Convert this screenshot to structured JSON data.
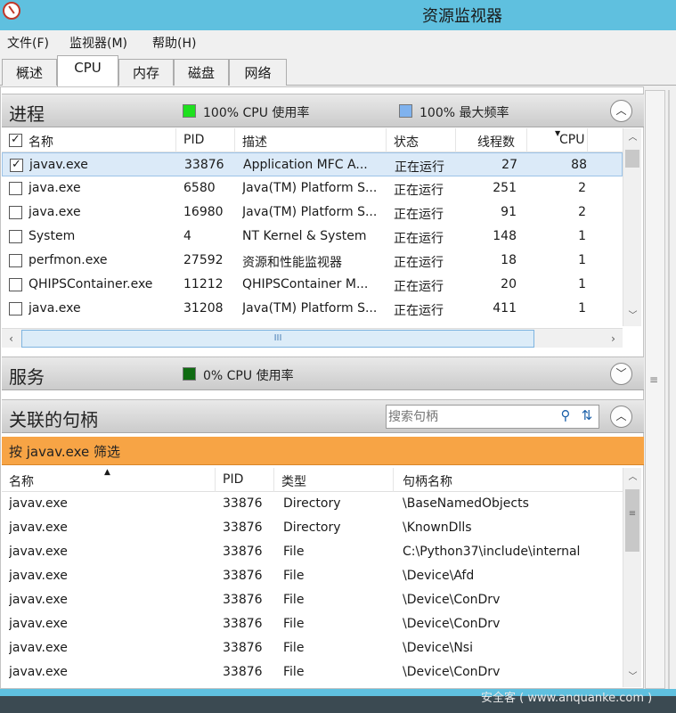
{
  "window": {
    "title": "资源监视器"
  },
  "menu": [
    "文件(F)",
    "监视器(M)",
    "帮助(H)"
  ],
  "tabs": [
    "概述",
    "CPU",
    "内存",
    "磁盘",
    "网络"
  ],
  "active_tab": "CPU",
  "processes": {
    "title": "进程",
    "cpu_legend": "100% CPU 使用率",
    "freq_legend": "100% 最大频率",
    "legend_colors": {
      "cpu": "#1ee01e",
      "freq": "#7fb2ee"
    },
    "columns": [
      "名称",
      "PID",
      "描述",
      "状态",
      "线程数",
      "CPU"
    ],
    "rows": [
      {
        "name": "javav.exe",
        "pid": "33876",
        "desc": "Application MFC A...",
        "status": "正在运行",
        "threads": "27",
        "cpu": "88",
        "checked": true
      },
      {
        "name": "java.exe",
        "pid": "6580",
        "desc": "Java(TM) Platform S...",
        "status": "正在运行",
        "threads": "251",
        "cpu": "2",
        "checked": false
      },
      {
        "name": "java.exe",
        "pid": "16980",
        "desc": "Java(TM) Platform S...",
        "status": "正在运行",
        "threads": "91",
        "cpu": "2",
        "checked": false
      },
      {
        "name": "System",
        "pid": "4",
        "desc": "NT Kernel & System",
        "status": "正在运行",
        "threads": "148",
        "cpu": "1",
        "checked": false
      },
      {
        "name": "perfmon.exe",
        "pid": "27592",
        "desc": "资源和性能监视器",
        "status": "正在运行",
        "threads": "18",
        "cpu": "1",
        "checked": false
      },
      {
        "name": "QHIPSContainer.exe",
        "pid": "11212",
        "desc": "QHIPSContainer M...",
        "status": "正在运行",
        "threads": "20",
        "cpu": "1",
        "checked": false
      },
      {
        "name": "java.exe",
        "pid": "31208",
        "desc": "Java(TM) Platform S...",
        "status": "正在运行",
        "threads": "411",
        "cpu": "1",
        "checked": false
      }
    ],
    "scroll_thumb": "III"
  },
  "services": {
    "title": "服务",
    "cpu_legend": "0% CPU 使用率",
    "legend_color": "#0f6b12"
  },
  "handles": {
    "title": "关联的句柄",
    "search_placeholder": "搜索句柄",
    "filter_text": "按 javav.exe 筛选",
    "columns": [
      "名称",
      "PID",
      "类型",
      "句柄名称"
    ],
    "rows": [
      {
        "name": "javav.exe",
        "pid": "33876",
        "type": "Directory",
        "handle": "\\BaseNamedObjects"
      },
      {
        "name": "javav.exe",
        "pid": "33876",
        "type": "Directory",
        "handle": "\\KnownDlls"
      },
      {
        "name": "javav.exe",
        "pid": "33876",
        "type": "File",
        "handle": "C:\\Python37\\include\\internal"
      },
      {
        "name": "javav.exe",
        "pid": "33876",
        "type": "File",
        "handle": "\\Device\\Afd"
      },
      {
        "name": "javav.exe",
        "pid": "33876",
        "type": "File",
        "handle": "\\Device\\ConDrv"
      },
      {
        "name": "javav.exe",
        "pid": "33876",
        "type": "File",
        "handle": "\\Device\\ConDrv"
      },
      {
        "name": "javav.exe",
        "pid": "33876",
        "type": "File",
        "handle": "\\Device\\Nsi"
      },
      {
        "name": "javav.exe",
        "pid": "33876",
        "type": "File",
        "handle": "\\Device\\ConDrv"
      }
    ]
  },
  "watermark": "安全客 ( www.anquanke.com )"
}
